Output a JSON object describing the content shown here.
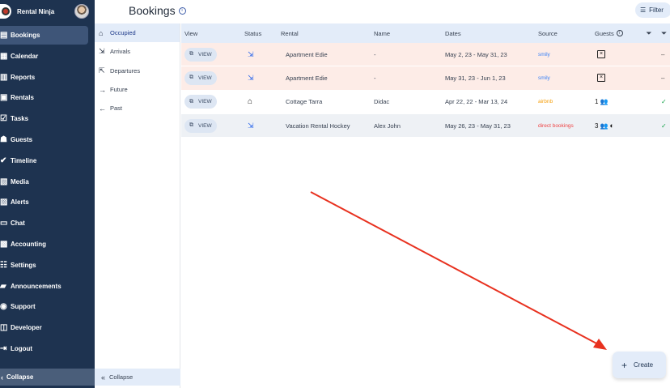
{
  "app": {
    "name": "Rental Ninja"
  },
  "sidebar": {
    "items": [
      {
        "label": "Bookings",
        "icon": "bookings-icon",
        "glyph": "▤",
        "active": true
      },
      {
        "label": "Calendar",
        "icon": "calendar-icon",
        "glyph": "▦"
      },
      {
        "label": "Reports",
        "icon": "reports-icon",
        "glyph": "▥"
      },
      {
        "label": "Rentals",
        "icon": "rentals-icon",
        "glyph": "▣"
      },
      {
        "label": "Tasks",
        "icon": "tasks-icon",
        "glyph": "☑"
      },
      {
        "label": "Guests",
        "icon": "guests-icon",
        "glyph": "☗"
      },
      {
        "label": "Timeline",
        "icon": "timeline-icon",
        "glyph": "✔"
      },
      {
        "label": "Media",
        "icon": "media-icon",
        "glyph": "▧"
      },
      {
        "label": "Alerts",
        "icon": "alerts-icon",
        "glyph": "▨"
      },
      {
        "label": "Chat",
        "icon": "chat-icon",
        "glyph": "▭"
      },
      {
        "label": "Accounting",
        "icon": "accounting-icon",
        "glyph": "▩"
      },
      {
        "label": "Settings",
        "icon": "settings-icon",
        "glyph": "☷"
      },
      {
        "label": "Announcements",
        "icon": "announcements-icon",
        "glyph": "▰"
      },
      {
        "label": "Support",
        "icon": "support-icon",
        "glyph": "◉"
      },
      {
        "label": "Developer",
        "icon": "developer-icon",
        "glyph": "◫"
      },
      {
        "label": "Logout",
        "icon": "logout-icon",
        "glyph": "⇥"
      }
    ],
    "collapse_label": "Collapse"
  },
  "subnav": {
    "items": [
      {
        "label": "Occupied",
        "icon": "home-icon",
        "glyph": "⌂",
        "active": true
      },
      {
        "label": "Arrivals",
        "icon": "arrivals-icon",
        "glyph": "⇲"
      },
      {
        "label": "Departures",
        "icon": "departures-icon",
        "glyph": "⇱"
      },
      {
        "label": "Future",
        "icon": "arrow-right-icon",
        "glyph": "→"
      },
      {
        "label": "Past",
        "icon": "arrow-left-icon",
        "glyph": "←"
      }
    ],
    "collapse_label": "Collapse"
  },
  "header": {
    "title": "Bookings",
    "filter_label": "Filter"
  },
  "table": {
    "columns": {
      "view": "View",
      "status": "Status",
      "rental": "Rental",
      "name": "Name",
      "dates": "Dates",
      "source": "Source",
      "guests": "Guests"
    },
    "view_label": "VIEW",
    "rows": [
      {
        "rental": "Apartment Edie",
        "name": "-",
        "dates": "May 2, 23 - May 31, 23",
        "source": "smily",
        "source_color": "#3b82f6",
        "guests": "",
        "status": "arrival",
        "bg": "pink",
        "more": "–"
      },
      {
        "rental": "Apartment Edie",
        "name": "-",
        "dates": "May 31, 23 - Jun 1, 23",
        "source": "smily",
        "source_color": "#3b82f6",
        "guests": "",
        "status": "arrival",
        "bg": "pink",
        "more": "–"
      },
      {
        "rental": "Cottage Tarra",
        "name": "Didac",
        "dates": "Apr 22, 22 - Mar 13, 24",
        "source": "airbnb",
        "source_color": "#f59e0b",
        "guests": "1",
        "status": "home",
        "bg": "white",
        "more": "✓"
      },
      {
        "rental": "Vacation Rental Hockey",
        "name": "Alex John",
        "dates": "May 26, 23 - May 31, 23",
        "source": "direct bookings",
        "source_color": "#ef4444",
        "guests": "3",
        "status": "arrival",
        "bg": "grey",
        "more": "✓"
      }
    ]
  },
  "create_button": {
    "label": "Create"
  },
  "colors": {
    "sidebar": "#1e3350",
    "accent": "#e3ecf9",
    "annotation_arrow": "#e8311f"
  }
}
